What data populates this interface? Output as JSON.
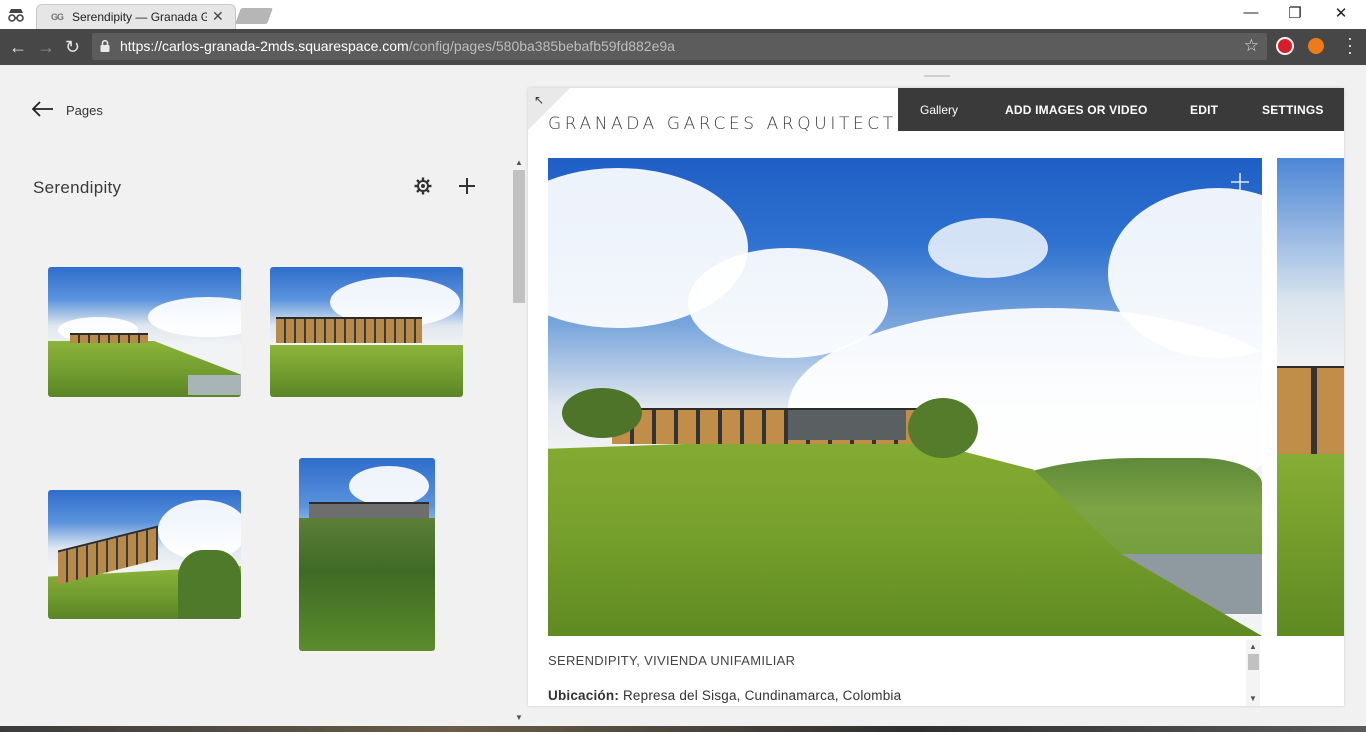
{
  "browser": {
    "tab": {
      "favicon_text": "GG",
      "title": "Serendipity — Granada G"
    },
    "url": {
      "host": "https://carlos-granada-2mds.squarespace.com",
      "path": "/config/pages/580ba385bebafb59fd882e9a"
    },
    "window_controls": {
      "minimize": "—",
      "maximize": "❐",
      "close": "✕"
    },
    "nav": {
      "back": "←",
      "forward": "→",
      "reload": "↻"
    }
  },
  "panel": {
    "back_label": "Pages",
    "page_title": "Serendipity",
    "thumbnails": [
      "thumbnail-1",
      "thumbnail-2",
      "thumbnail-3",
      "thumbnail-4"
    ]
  },
  "site": {
    "title": "GRANADA GARCES ARQUITECTOS",
    "editbar": {
      "gallery": "Gallery",
      "add": "ADD IMAGES OR VIDEO",
      "edit": "EDIT",
      "settings": "SETTINGS"
    },
    "caption": {
      "title": "SERENDIPITY, VIVIENDA UNIFAMILIAR",
      "location_label": "Ubicación:",
      "location_value": " Represa del Sisga, Cundinamarca, Colombia"
    }
  },
  "icons": {
    "incognito": "incognito-icon",
    "lock": "lock-icon",
    "star": "bookmark-star-icon",
    "opera": "adblock-extension-icon",
    "fox": "extension-fox-icon",
    "back_arrow": "arrow-left-icon",
    "gear": "gear-icon",
    "plus": "plus-icon",
    "expand": "expand-icon"
  },
  "colors": {
    "editbar": "#3a3a3a",
    "toolbar": "#474747",
    "panel": "#f1f1f1"
  }
}
